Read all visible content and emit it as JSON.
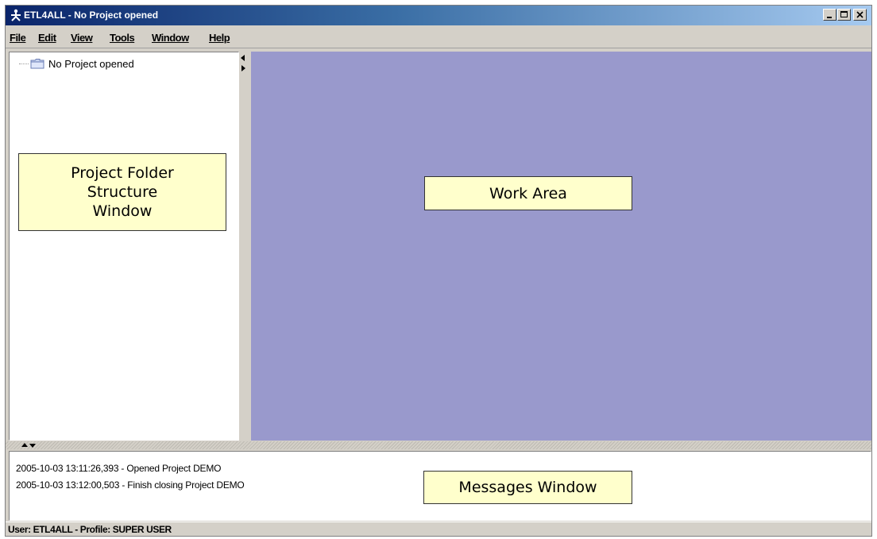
{
  "window": {
    "title": "ETL4ALL - No  Project opened",
    "icon": "etl4all-logo-icon",
    "controls": [
      "minimize-icon",
      "maximize-icon",
      "close-icon"
    ]
  },
  "menu": {
    "items": [
      {
        "label": "File"
      },
      {
        "label": "Edit"
      },
      {
        "label": "View"
      },
      {
        "label": "Tools"
      },
      {
        "label": "Window"
      },
      {
        "label": "Help"
      }
    ]
  },
  "tree": {
    "root_label": "No  Project opened",
    "root_icon": "folder-icon"
  },
  "work_area": {
    "background": "#9999cc"
  },
  "messages": [
    "2005-10-03 13:11:26,393 - Opened Project DEMO",
    "2005-10-03 13:12:00,503 - Finish closing Project DEMO"
  ],
  "status": {
    "text": "User: ETL4ALL - Profile: SUPER USER"
  },
  "callouts": {
    "project_folder": [
      "Project Folder",
      "Structure",
      "Window"
    ],
    "work_area": "Work Area",
    "messages": "Messages Window"
  },
  "colors": {
    "titlebar_start": "#0a246a",
    "titlebar_end": "#a6caf0",
    "callout_background": "#ffffcc",
    "chrome": "#d4d0c8"
  }
}
